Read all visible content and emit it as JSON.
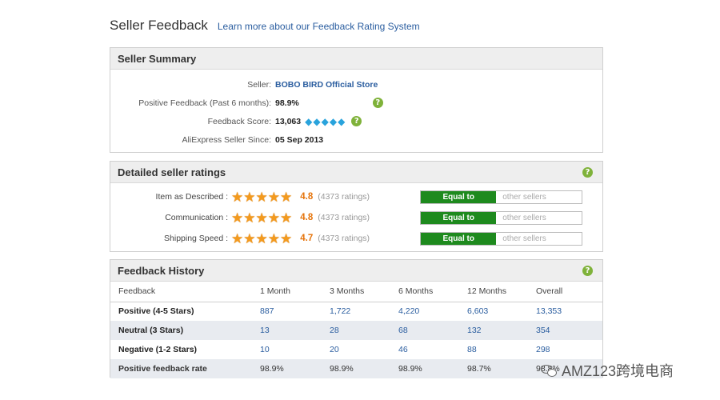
{
  "header": {
    "title": "Seller Feedback",
    "link": "Learn more about our Feedback Rating System"
  },
  "summary": {
    "title": "Seller Summary",
    "seller_label": "Seller:",
    "seller_name": "BOBO BIRD Official Store",
    "positive_label": "Positive Feedback (Past 6 months):",
    "positive_value": "98.9%",
    "score_label": "Feedback Score:",
    "score_value": "13,063",
    "score_diamonds": 5,
    "since_label": "AliExpress Seller Since:",
    "since_value": "05 Sep 2013"
  },
  "detailed": {
    "title": "Detailed seller ratings",
    "ratings": [
      {
        "label": "Item as Described :",
        "stars": 5,
        "score": "4.8",
        "count": "(4373 ratings)",
        "equal": "Equal to",
        "other": "other sellers"
      },
      {
        "label": "Communication :",
        "stars": 5,
        "score": "4.8",
        "count": "(4373 ratings)",
        "equal": "Equal to",
        "other": "other sellers"
      },
      {
        "label": "Shipping Speed :",
        "stars": 5,
        "score": "4.7",
        "count": "(4373 ratings)",
        "equal": "Equal to",
        "other": "other sellers"
      }
    ]
  },
  "history": {
    "title": "Feedback History",
    "columns": [
      "Feedback",
      "1 Month",
      "3 Months",
      "6 Months",
      "12 Months",
      "Overall"
    ],
    "rows": [
      {
        "label": "Positive (4-5 Stars)",
        "values": [
          "887",
          "1,722",
          "4,220",
          "6,603",
          "13,353"
        ]
      },
      {
        "label": "Neutral (3 Stars)",
        "values": [
          "13",
          "28",
          "68",
          "132",
          "354"
        ]
      },
      {
        "label": "Negative (1-2 Stars)",
        "values": [
          "10",
          "20",
          "46",
          "88",
          "298"
        ]
      },
      {
        "label": "Positive feedback rate",
        "values": [
          "98.9%",
          "98.9%",
          "98.9%",
          "98.7%",
          "98.8%"
        ]
      }
    ]
  },
  "watermark": {
    "text": "AMZ123跨境电商"
  },
  "colors": {
    "accent_link": "#2a5d9f",
    "equal_green": "#1e8a1e",
    "star_orange": "#f39a1e",
    "score_orange": "#e5740b",
    "diamond_blue": "#29a3dc"
  }
}
